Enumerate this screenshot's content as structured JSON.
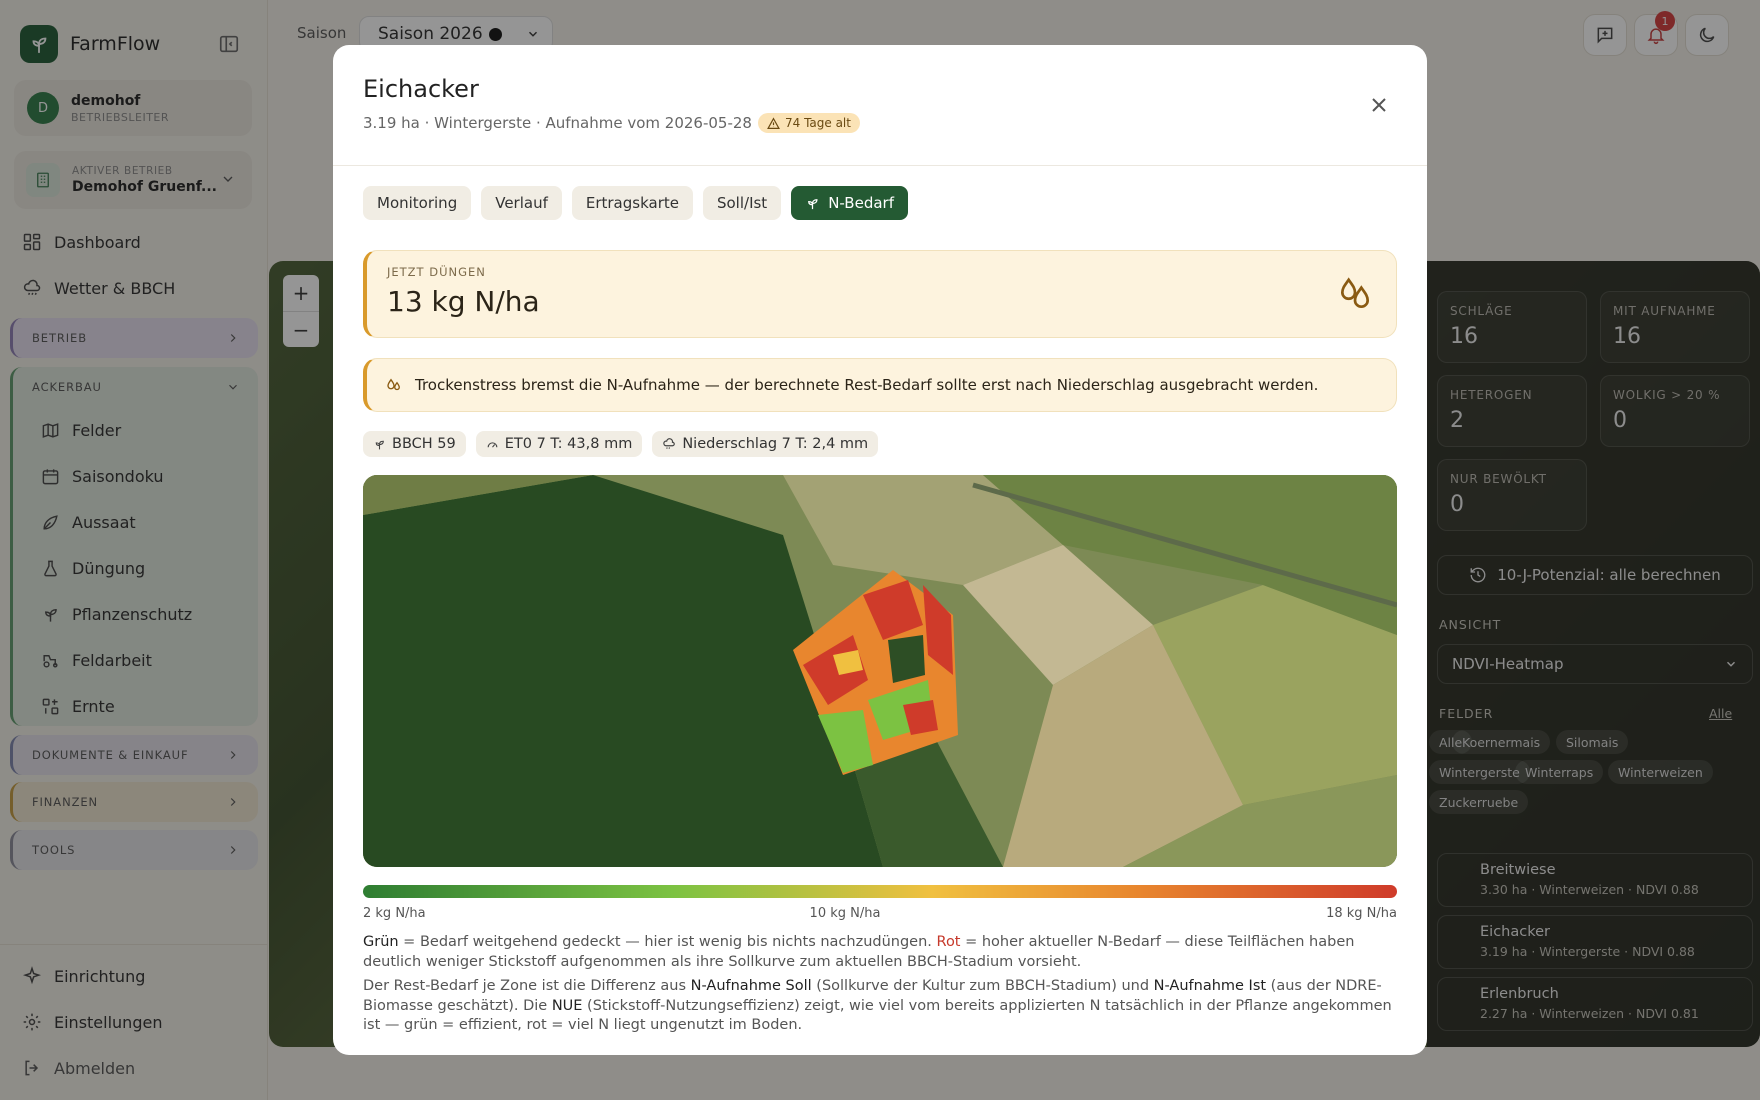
{
  "app": {
    "name": "FarmFlow"
  },
  "user": {
    "initial": "D",
    "name": "demohof",
    "role": "BETRIEBSLEITER"
  },
  "farm": {
    "label": "AKTIVER BETRIEB",
    "name": "Demohof Gruenf..."
  },
  "nav": {
    "dashboard": "Dashboard",
    "wetter": "Wetter & BBCH",
    "groups": {
      "betrieb": "BETRIEB",
      "ackerbau": "ACKERBAU",
      "dokumente": "DOKUMENTE & EINKAUF",
      "finanzen": "FINANZEN",
      "tools": "TOOLS"
    },
    "ackerbau_items": [
      "Felder",
      "Saisondoku",
      "Aussaat",
      "Düngung",
      "Pflanzenschutz",
      "Feldarbeit",
      "Ernte"
    ],
    "einrichtung": "Einrichtung",
    "einstellungen": "Einstellungen",
    "abmelden": "Abmelden"
  },
  "topbar": {
    "season_label": "Saison",
    "season_value": "Saison 2026",
    "notification_count": "1"
  },
  "background_panel": {
    "stats": [
      {
        "label": "SCHLÄGE",
        "value": "16"
      },
      {
        "label": "MIT AUFNAHME",
        "value": "16"
      },
      {
        "label": "HETEROGEN",
        "value": "2"
      },
      {
        "label": "WOLKIG > 20 %",
        "value": "0"
      },
      {
        "label": "NUR BEWÖLKT",
        "value": "0"
      }
    ],
    "potential_button": "10-J-Potenzial: alle berechnen",
    "ansicht_label": "ANSICHT",
    "ansicht_value": "NDVI-Heatmap",
    "felder_label": "FELDER",
    "felder_all": "Alle",
    "crop_chips": [
      "Alle",
      "Koernermais",
      "Silomais",
      "Wintergerste",
      "Winterraps",
      "Winterweizen",
      "Zuckerruebe"
    ],
    "fields": [
      {
        "name": "Breitwiese",
        "meta": "3.30 ha · Winterweizen · NDVI 0.88"
      },
      {
        "name": "Eichacker",
        "meta": "3.19 ha · Wintergerste · NDVI 0.88"
      },
      {
        "name": "Erlenbruch",
        "meta": "2.27 ha · Winterweizen · NDVI 0.81"
      }
    ]
  },
  "modal": {
    "title": "Eichacker",
    "subtitle": "3.19 ha · Wintergerste · Aufnahme vom 2026-05-28",
    "age_badge": "74 Tage alt",
    "tabs": [
      "Monitoring",
      "Verlauf",
      "Ertragskarte",
      "Soll/Ist",
      "N-Bedarf"
    ],
    "active_tab": "N-Bedarf",
    "now_label": "JETZT DÜNGEN",
    "now_value": "13 kg N/ha",
    "alert": "Trockenstress bremst die N-Aufnahme — der berechnete Rest-Bedarf sollte erst nach Niederschlag ausgebracht werden.",
    "chips": {
      "bbch": "BBCH 59",
      "eto": "ET0 7 T: 43,8 mm",
      "rain": "Niederschlag 7 T: 2,4 mm"
    },
    "scale": {
      "min": "2 kg N/ha",
      "mid": "10 kg N/ha",
      "max": "18 kg N/ha"
    },
    "legend": {
      "green_word": "Grün",
      "green_text": " = Bedarf weitgehend gedeckt — hier ist wenig bis nichts nachzudüngen. ",
      "red_word": "Rot",
      "red_text": " = hoher aktueller N-Bedarf — diese Teilflächen haben deutlich weniger Stickstoff aufgenommen als ihre Sollkurve zum aktuellen BBCH-Stadium vorsieht.",
      "p2_a": "Der Rest-Bedarf je Zone ist die Differenz aus ",
      "p2_soll": "N-Aufnahme Soll",
      "p2_b": " (Sollkurve der Kultur zum BBCH-Stadium) und ",
      "p2_ist": "N-Aufnahme Ist",
      "p2_c": " (aus der NDRE-Biomasse geschätzt). Die ",
      "p2_nue": "NUE",
      "p2_d": " (Stickstoff-Nutzungseffizienz) zeigt, wie viel vom bereits applizierten N tatsächlich in der Pflanze angekommen ist — grün = effizient, rot = viel N liegt ungenutzt im Boden."
    }
  },
  "colors": {
    "brand": "#245a33",
    "warning_bg": "#fdf3de",
    "warning_accent": "#d99a2b",
    "need_high": "#cf3b2a",
    "need_low": "#7cc242"
  }
}
